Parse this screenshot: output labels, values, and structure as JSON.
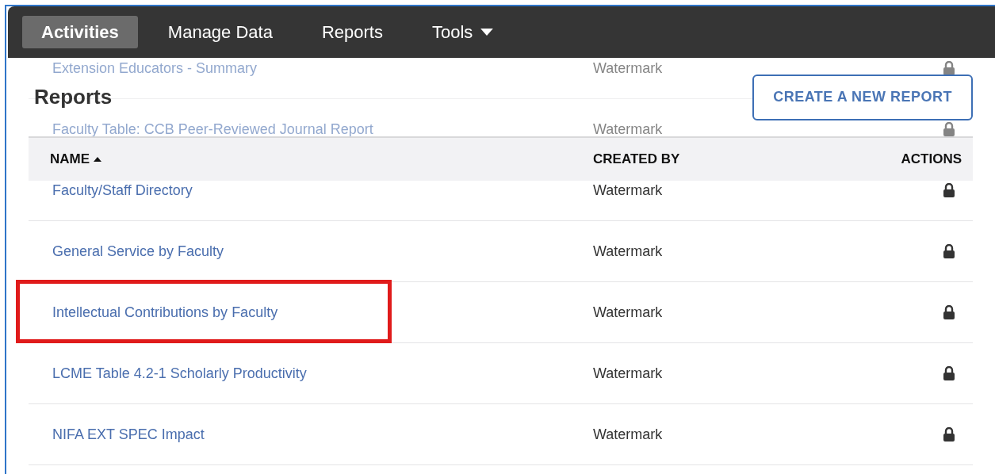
{
  "nav": {
    "tabs": [
      {
        "label": "Activities",
        "selected": true,
        "dropdown": false
      },
      {
        "label": "Manage Data",
        "selected": false,
        "dropdown": false
      },
      {
        "label": "Reports",
        "selected": false,
        "dropdown": false
      },
      {
        "label": "Tools",
        "selected": false,
        "dropdown": true
      }
    ]
  },
  "page": {
    "title": "Reports",
    "create_button": "CREATE A NEW REPORT"
  },
  "table": {
    "columns": [
      {
        "label": "NAME",
        "sorted": true
      },
      {
        "label": "CREATED BY",
        "sorted": false
      },
      {
        "label": "ACTIONS",
        "sorted": false
      }
    ],
    "rows": [
      {
        "name": "Extension Educators - Summary",
        "created_by": "Watermark",
        "locked": true,
        "highlighted": false
      },
      {
        "name": "Faculty Table: CCB Peer-Reviewed Journal Report",
        "created_by": "Watermark",
        "locked": true,
        "highlighted": false
      },
      {
        "name": "Faculty/Staff Directory",
        "created_by": "Watermark",
        "locked": true,
        "highlighted": false
      },
      {
        "name": "General Service by Faculty",
        "created_by": "Watermark",
        "locked": true,
        "highlighted": false
      },
      {
        "name": "Intellectual Contributions by Faculty",
        "created_by": "Watermark",
        "locked": true,
        "highlighted": true
      },
      {
        "name": "LCME Table 4.2-1 Scholarly Productivity",
        "created_by": "Watermark",
        "locked": true,
        "highlighted": false
      },
      {
        "name": "NIFA EXT SPEC Impact",
        "created_by": "Watermark",
        "locked": true,
        "highlighted": false
      }
    ]
  }
}
